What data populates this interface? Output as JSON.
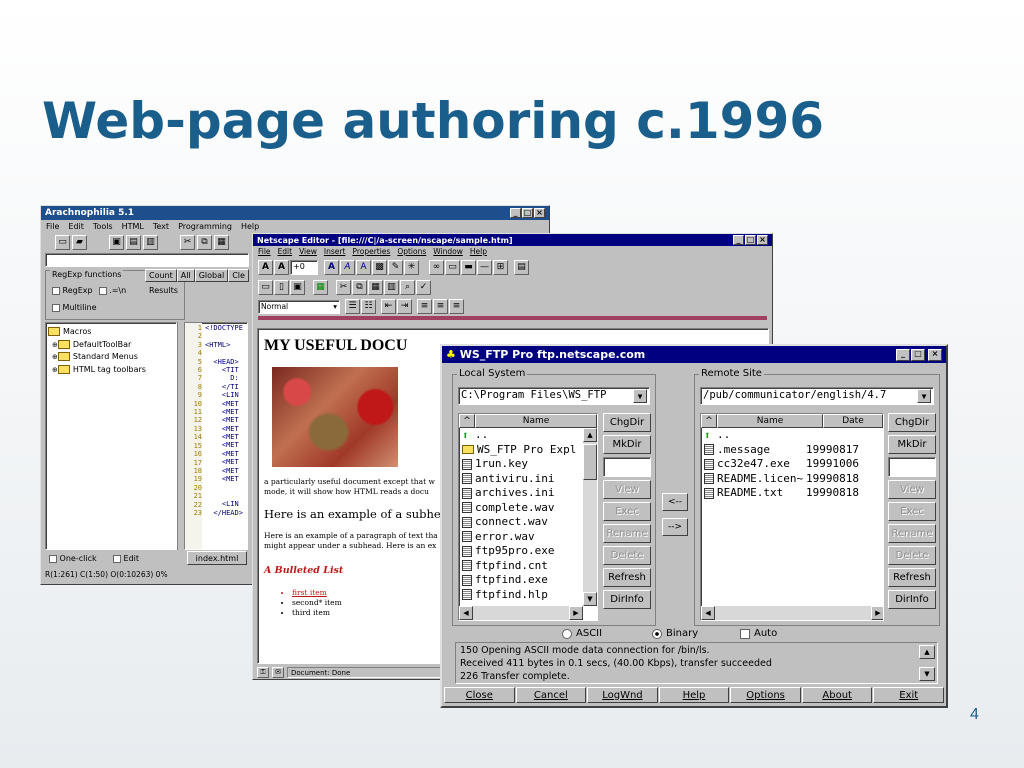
{
  "slide": {
    "title": "Web-page authoring c.1996",
    "page_number": "4"
  },
  "colors": {
    "title": "#1a5f8c",
    "titlebar": "#000080",
    "arach_titlebar": "#1e4e8c"
  },
  "arachnophilia": {
    "title": "Arachnophilia 5.1",
    "menu": [
      "File",
      "Edit",
      "Tools",
      "HTML",
      "Text",
      "Programming",
      "Help"
    ],
    "regexp_label": "RegExp functions",
    "tabs": [
      "Count",
      "All",
      "Global",
      "Cle"
    ],
    "checks": [
      "RegExp",
      ".=\\n",
      "Multiline"
    ],
    "results_label": "Results",
    "tree": [
      "Macros",
      "DefaultToolBar",
      "Standard Menus",
      "HTML tag toolbars"
    ],
    "line_numbers": [
      "1",
      "2",
      "3",
      "4",
      "5",
      "6",
      "7",
      "8",
      "9",
      "10",
      "11",
      "12",
      "13",
      "14",
      "15",
      "16",
      "17",
      "18",
      "19",
      "20",
      "21",
      "22",
      "23"
    ],
    "code_lines": [
      "<!DOCTYPE",
      "",
      "<HTML>",
      "",
      "  <HEAD>",
      "    <TIT",
      "      D:",
      "    </TI",
      "    <LIN",
      "    <MET",
      "    <MET",
      "    <MET",
      "    <MET",
      "    <MET",
      "    <MET",
      "    <MET",
      "    <MET",
      "    <MET",
      "    <MET",
      "",
      "",
      "    <LIN",
      "  </HEAD>"
    ],
    "bottom_checks": [
      "One-click",
      "Edit"
    ],
    "file_tab": "index.html",
    "status": "R(1:261) C(1:50) O(0:10263) 0%"
  },
  "netscape": {
    "title": "Netscape Editor - [file:///C|/a-screen/nscape/sample.htm]",
    "menu": [
      "File",
      "Edit",
      "View",
      "Insert",
      "Properties",
      "Options",
      "Window",
      "Help"
    ],
    "font_size": "+0",
    "style": "Normal",
    "heading": "MY USEFUL DOCU",
    "para1": "a particularly useful document except that w mode, it will show how HTML reads a docu",
    "subhead": "Here is an example of a subhea",
    "para2": "Here is an example of a paragraph of text tha might appear under a subhead. Here is an ex",
    "list_heading": "A Bulleted List",
    "list": [
      "first item",
      "second* item",
      "third item"
    ],
    "status": "Document: Done"
  },
  "wsftp": {
    "title": "WS_FTP Pro ftp.netscape.com",
    "local_label": "Local System",
    "local_path": "C:\\Program Files\\WS_FTP",
    "remote_label": "Remote Site",
    "remote_path": "/pub/communicator/english/4.7",
    "name_header": "Name",
    "date_header": "Date",
    "local_files": [
      {
        "name": "..",
        "icon": "up-arrow-icon"
      },
      {
        "name": "WS_FTP Pro Expl",
        "icon": "folder-icon"
      },
      {
        "name": "1run.key",
        "icon": "file-icon"
      },
      {
        "name": "antiviru.ini",
        "icon": "file-icon"
      },
      {
        "name": "archives.ini",
        "icon": "file-icon"
      },
      {
        "name": "complete.wav",
        "icon": "file-icon"
      },
      {
        "name": "connect.wav",
        "icon": "file-icon"
      },
      {
        "name": "error.wav",
        "icon": "file-icon"
      },
      {
        "name": "ftp95pro.exe",
        "icon": "file-icon"
      },
      {
        "name": "ftpfind.cnt",
        "icon": "file-icon"
      },
      {
        "name": "ftpfind.exe",
        "icon": "file-icon"
      },
      {
        "name": "ftpfind.hlp",
        "icon": "file-icon"
      }
    ],
    "remote_files": [
      {
        "name": "..",
        "date": "",
        "icon": "up-arrow-icon"
      },
      {
        "name": ".message",
        "date": "19990817",
        "icon": "file-icon"
      },
      {
        "name": "cc32e47.exe",
        "date": "19991006",
        "icon": "file-icon"
      },
      {
        "name": "README.licen~",
        "date": "19990818",
        "icon": "file-icon"
      },
      {
        "name": "README.txt",
        "date": "19990818",
        "icon": "file-icon"
      }
    ],
    "side_buttons": [
      "ChgDir",
      "MkDir",
      "",
      "View",
      "Exec",
      "Rename",
      "Delete",
      "Refresh",
      "DirInfo"
    ],
    "transfer_left": "<--",
    "transfer_right": "-->",
    "modes": [
      "ASCII",
      "Binary"
    ],
    "selected_mode": "Binary",
    "auto_label": "Auto",
    "log": [
      "150 Opening ASCII mode data connection for /bin/ls.",
      "Received 411 bytes in 0.1 secs, (40.00 Kbps), transfer succeeded",
      "226 Transfer complete."
    ],
    "bottom_buttons": [
      "Close",
      "Cancel",
      "LogWnd",
      "Help",
      "Options",
      "About",
      "Exit"
    ]
  }
}
